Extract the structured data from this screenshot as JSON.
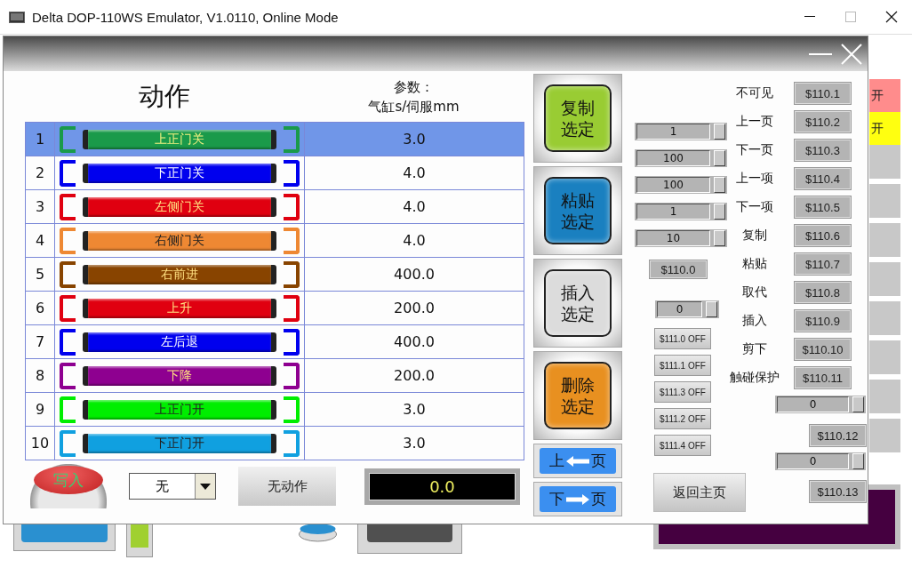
{
  "window": {
    "title": "Delta DOP-110WS Emulator, V1.0110, Online Mode"
  },
  "background": {
    "side_buttons": [
      {
        "label": "开",
        "color": "#ff8c8c"
      },
      {
        "label": "开",
        "color": "#ffff10"
      },
      {
        "color": "#c8c8c8"
      },
      {
        "color": "#c8c8c8"
      },
      {
        "color": "#c8c8c8"
      },
      {
        "color": "#c8c8c8"
      },
      {
        "color": "#c8c8c8"
      },
      {
        "color": "#c8c8c8"
      },
      {
        "color": "#c8c8c8"
      },
      {
        "color": "#c8c8c8"
      }
    ]
  },
  "popup": {
    "action_heading": "动作",
    "param_heading": [
      "参数：",
      "气缸s/伺服mm"
    ],
    "rows": [
      {
        "number": "1",
        "action": "上正门关",
        "color": "#1a9a4a",
        "kind": "pale",
        "value": "3.0",
        "selected": true
      },
      {
        "number": "2",
        "action": "下正门关",
        "color": "#0000ee",
        "kind": "white",
        "value": "4.0",
        "selected": false
      },
      {
        "number": "3",
        "action": "左侧门关",
        "color": "#e00010",
        "kind": "yellow",
        "value": "4.0",
        "selected": false
      },
      {
        "number": "4",
        "action": "右侧门关",
        "color": "#ee8833",
        "kind": "dark",
        "value": "4.0",
        "selected": false
      },
      {
        "number": "5",
        "action": "右前进",
        "color": "#884400",
        "kind": "yellow",
        "value": "400.0",
        "selected": false
      },
      {
        "number": "6",
        "action": "上升",
        "color": "#e00010",
        "kind": "yellow",
        "value": "200.0",
        "selected": false
      },
      {
        "number": "7",
        "action": "左后退",
        "color": "#0000ee",
        "kind": "white",
        "value": "400.0",
        "selected": false
      },
      {
        "number": "8",
        "action": "下降",
        "color": "#8e0090",
        "kind": "yellow",
        "value": "200.0",
        "selected": false
      },
      {
        "number": "9",
        "action": "上正门开",
        "color": "#00ee00",
        "kind": "dark",
        "value": "3.0",
        "selected": false
      },
      {
        "number": "10",
        "action": "下正门开",
        "color": "#10a0e0",
        "kind": "dark",
        "value": "3.0",
        "selected": false
      }
    ],
    "write_button": "写入",
    "dropdown": {
      "value": "无"
    },
    "no_action_button": "无动作",
    "display": "0.0",
    "action_buttons": [
      {
        "lines": [
          "复制",
          "选定"
        ],
        "color": "#99cc33"
      },
      {
        "lines": [
          "粘贴",
          "选定"
        ],
        "color": "#1a80c0"
      },
      {
        "lines": [
          "插入",
          "选定"
        ],
        "color": "#dcdcdc"
      },
      {
        "lines": [
          "删除",
          "选定"
        ],
        "color": "#e89020"
      }
    ],
    "page_buttons": [
      {
        "left": "上",
        "right": "页",
        "kind": "left"
      },
      {
        "left": "下",
        "right": "页",
        "kind": "right"
      }
    ],
    "spinners": [
      "1",
      "100",
      "100",
      "1",
      "10"
    ],
    "address_tag": "$110.0",
    "mid_spinner": "0",
    "off_buttons": [
      "$111.0 OFF",
      "$111.1 OFF",
      "$111.3 OFF",
      "$111.2 OFF",
      "$111.4 OFF"
    ],
    "home_button": "返回主页",
    "flags": [
      {
        "label": "不可见",
        "address": "$110.1"
      },
      {
        "label": "上一页",
        "address": "$110.2"
      },
      {
        "label": "下一页",
        "address": "$110.3"
      },
      {
        "label": "上一项",
        "address": "$110.4"
      },
      {
        "label": "下一项",
        "address": "$110.5"
      },
      {
        "label": "复制",
        "address": "$110.6"
      },
      {
        "label": "粘贴",
        "address": "$110.7"
      },
      {
        "label": "取代",
        "address": "$110.8"
      },
      {
        "label": "插入",
        "address": "$110.9"
      },
      {
        "label": "剪下",
        "address": "$110.10"
      },
      {
        "label": "触碰保护",
        "address": "$110.11"
      }
    ],
    "extras": [
      {
        "kind": "spinner",
        "value": "0"
      },
      {
        "kind": "tag",
        "value": "$110.12"
      },
      {
        "kind": "spinner",
        "value": "0"
      },
      {
        "kind": "tag",
        "value": "$110.13"
      }
    ]
  }
}
